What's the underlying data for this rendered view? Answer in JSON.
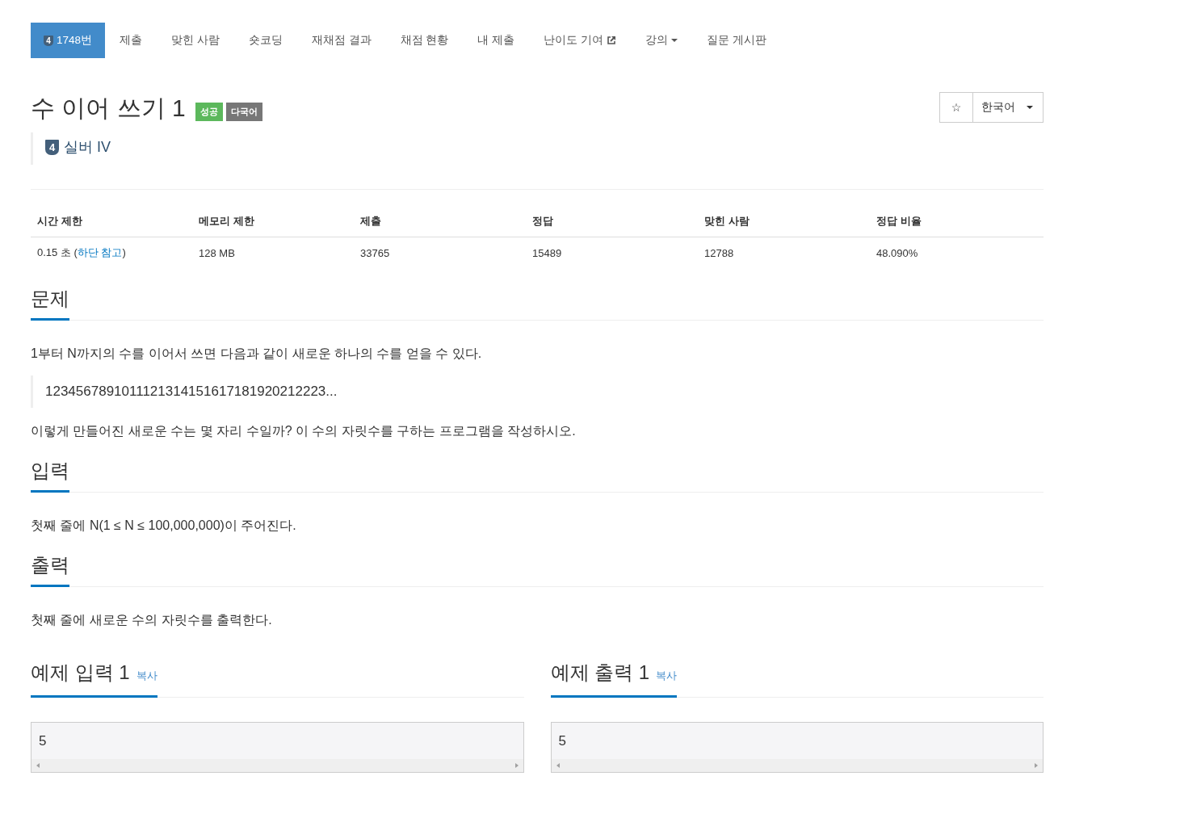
{
  "nav": [
    {
      "label": "1748번",
      "kind": "problem",
      "tier": "4",
      "selected": true
    },
    {
      "label": "제출",
      "kind": "plain",
      "selected": false
    },
    {
      "label": "맞힌 사람",
      "kind": "plain",
      "selected": false
    },
    {
      "label": "숏코딩",
      "kind": "plain",
      "selected": false
    },
    {
      "label": "재채점 결과",
      "kind": "plain",
      "selected": false
    },
    {
      "label": "채점 현황",
      "kind": "plain",
      "selected": false
    },
    {
      "label": "내 제출",
      "kind": "plain",
      "selected": false
    },
    {
      "label": "난이도 기여",
      "kind": "external",
      "selected": false
    },
    {
      "label": "강의",
      "kind": "dropdown",
      "selected": false
    },
    {
      "label": "질문 게시판",
      "kind": "plain",
      "selected": false
    }
  ],
  "title": "수 이어 쓰기 1",
  "labels": [
    {
      "text": "성공",
      "color": "#5cb85c"
    },
    {
      "text": "다국어",
      "color": "#777777"
    }
  ],
  "star_button": "☆",
  "language": "한국어",
  "tier": {
    "number": "4",
    "name": "실버 IV"
  },
  "stats": {
    "columns": [
      "시간 제한",
      "메모리 제한",
      "제출",
      "정답",
      "맞힌 사람",
      "정답 비율"
    ],
    "row": [
      {
        "before": "0.15 초 (",
        "link": "하단 참고",
        "after": ")"
      },
      {
        "before": "128 MB"
      },
      {
        "before": "33765"
      },
      {
        "before": "15489"
      },
      {
        "before": "12788"
      },
      {
        "before": "48.090%"
      }
    ]
  },
  "sections": [
    {
      "heading": "문제",
      "blocks": [
        {
          "kind": "text",
          "text": "1부터 N까지의 수를 이어서 쓰면 다음과 같이 새로운 하나의 수를 얻을 수 있다."
        },
        {
          "kind": "quote",
          "text": "1234567891011121314151617181920212223..."
        },
        {
          "kind": "text",
          "text": "이렇게 만들어진 새로운 수는 몇 자리 수일까? 이 수의 자릿수를 구하는 프로그램을 작성하시오."
        }
      ]
    },
    {
      "heading": "입력",
      "blocks": [
        {
          "kind": "text",
          "text": "첫째 줄에 N(1 ≤ N ≤ 100,000,000)이 주어진다."
        }
      ]
    },
    {
      "heading": "출력",
      "blocks": [
        {
          "kind": "text",
          "text": "첫째 줄에 새로운 수의 자릿수를 출력한다."
        }
      ]
    }
  ],
  "samples": [
    {
      "title": "예제 입력 1",
      "copy": "복사",
      "value": "5"
    },
    {
      "title": "예제 출력 1",
      "copy": "복사",
      "value": "5"
    }
  ]
}
